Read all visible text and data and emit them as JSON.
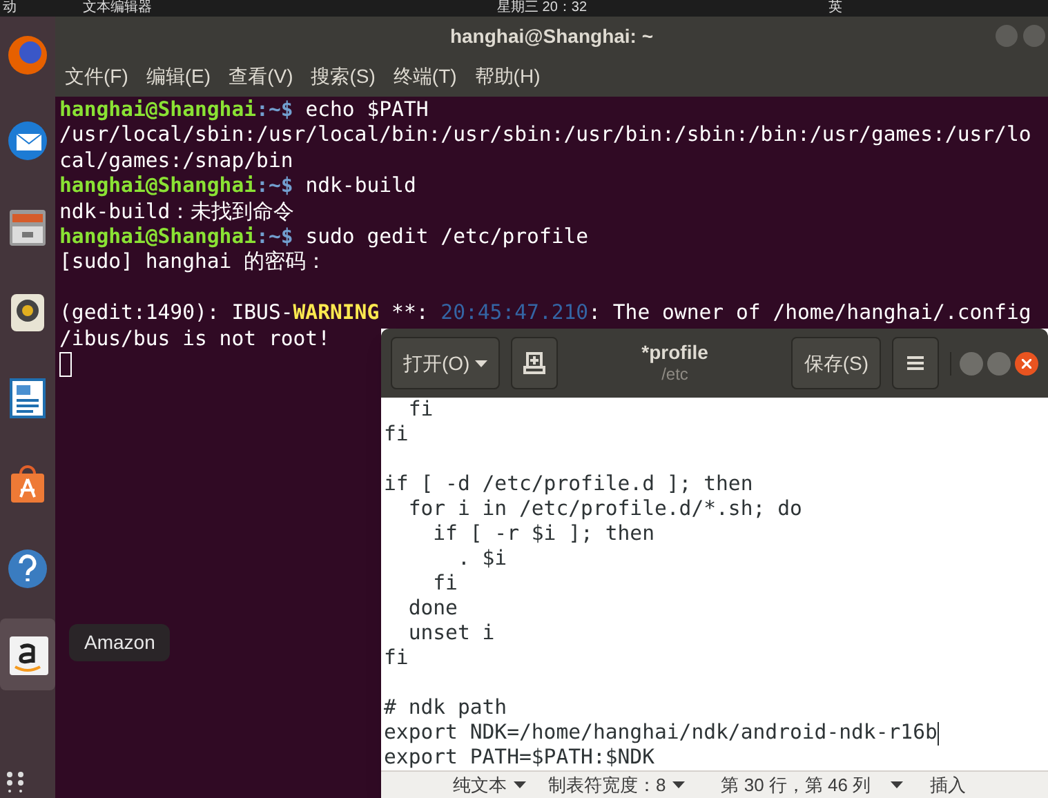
{
  "top_bar": {
    "activities": "动",
    "app_menu": "文本编辑器",
    "clock": "星期三 20：32",
    "input_method": "英"
  },
  "dock": {
    "items": [
      {
        "kind": "firefox",
        "selected": false
      },
      {
        "kind": "mail",
        "selected": false
      },
      {
        "kind": "files",
        "selected": false
      },
      {
        "kind": "music",
        "selected": false
      },
      {
        "kind": "writer",
        "selected": false
      },
      {
        "kind": "software",
        "selected": false
      },
      {
        "kind": "help",
        "selected": false
      },
      {
        "kind": "amazon",
        "selected": true
      }
    ],
    "tooltip": "Amazon"
  },
  "terminal": {
    "title": "hanghai@Shanghai: ~",
    "menu": [
      "文件(F)",
      "编辑(E)",
      "查看(V)",
      "搜索(S)",
      "终端(T)",
      "帮助(H)"
    ],
    "lines": [
      {
        "kind": "prompt",
        "user": "hanghai@Shanghai",
        "path": ":~$ ",
        "command": "echo $PATH"
      },
      {
        "kind": "output",
        "text": "/usr/local/sbin:/usr/local/bin:/usr/sbin:/usr/bin:/sbin:/bin:/usr/games:/usr/lo"
      },
      {
        "kind": "output",
        "text": "cal/games:/snap/bin"
      },
      {
        "kind": "prompt",
        "user": "hanghai@Shanghai",
        "path": ":~$ ",
        "command": "ndk-build"
      },
      {
        "kind": "output",
        "text": "ndk-build：未找到命令"
      },
      {
        "kind": "prompt",
        "user": "hanghai@Shanghai",
        "path": ":~$ ",
        "command": "sudo gedit /etc/profile"
      },
      {
        "kind": "output",
        "text": "[sudo] hanghai 的密码："
      },
      {
        "kind": "blank"
      },
      {
        "kind": "warning",
        "source": "(gedit:1490): IBUS-",
        "level": "WARNING",
        "stars": " **: ",
        "time": "20:45:47.210",
        "message": ": The owner of /home/hanghai/.config"
      },
      {
        "kind": "output",
        "text": "/ibus/bus is not root!"
      },
      {
        "kind": "cursor"
      }
    ]
  },
  "editor": {
    "open_button": "打开(O)",
    "title": "*profile",
    "subtitle": "/etc",
    "save_button": "保存(S)",
    "lines": [
      {
        "kind": "text",
        "text": "  fi",
        "cursor": false
      },
      {
        "kind": "text",
        "text": "fi",
        "cursor": false
      },
      {
        "kind": "blank"
      },
      {
        "kind": "text",
        "text": "if [ -d /etc/profile.d ]; then",
        "cursor": false
      },
      {
        "kind": "text",
        "text": "  for i in /etc/profile.d/*.sh; do",
        "cursor": false
      },
      {
        "kind": "text",
        "text": "    if [ -r $i ]; then",
        "cursor": false
      },
      {
        "kind": "text",
        "text": "      . $i",
        "cursor": false
      },
      {
        "kind": "text",
        "text": "    fi",
        "cursor": false
      },
      {
        "kind": "text",
        "text": "  done",
        "cursor": false
      },
      {
        "kind": "text",
        "text": "  unset i",
        "cursor": false
      },
      {
        "kind": "text",
        "text": "fi",
        "cursor": false
      },
      {
        "kind": "blank"
      },
      {
        "kind": "text",
        "text": "# ndk path",
        "cursor": false
      },
      {
        "kind": "text",
        "text": "export NDK=/home/hanghai/ndk/android-ndk-r16b",
        "cursor": true
      },
      {
        "kind": "text",
        "text": "export PATH=$PATH:$NDK",
        "cursor": false
      }
    ],
    "status_bar": {
      "syntax": "纯文本",
      "tab_width": "制表符宽度：8",
      "position": "第 30 行，第 46 列",
      "mode": "插入"
    }
  }
}
